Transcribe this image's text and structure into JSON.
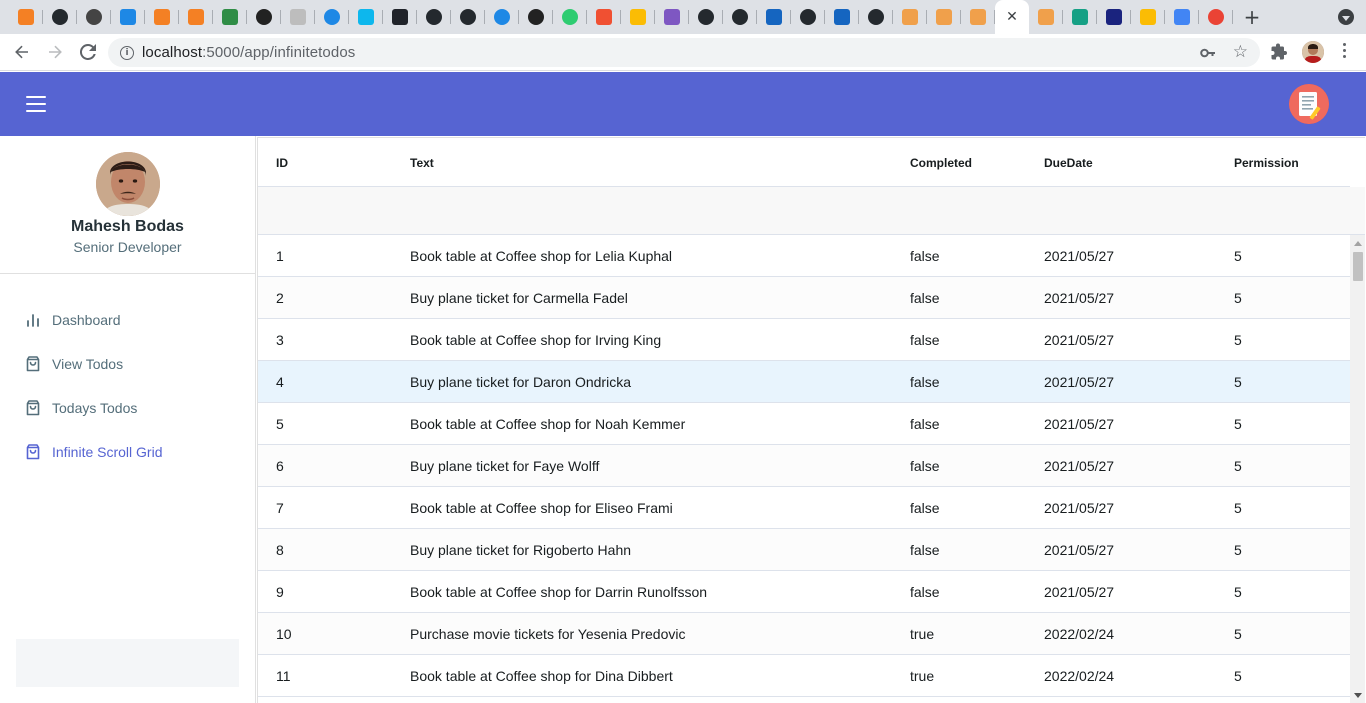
{
  "browser": {
    "active_tab_close": "✕",
    "new_tab": "+",
    "tab_favicons": [
      {
        "name": "stackoverflow-favicon",
        "color": "#f48024"
      },
      {
        "name": "github-favicon",
        "color": "#24292e"
      },
      {
        "name": "eye-favicon",
        "color": "#444444"
      },
      {
        "name": "blue-favicon",
        "color": "#1e88e5"
      },
      {
        "name": "stackoverflow-favicon",
        "color": "#f48024"
      },
      {
        "name": "stackoverflow-favicon",
        "color": "#f48024"
      },
      {
        "name": "geeksforgeeks-favicon",
        "color": "#2f8d46"
      },
      {
        "name": "hexagon-favicon",
        "color": "#222222"
      },
      {
        "name": "doc-favicon",
        "color": "#bdbdbd"
      },
      {
        "name": "edge-favicon",
        "color": "#1e88e5"
      },
      {
        "name": "docker-favicon",
        "color": "#0db7ed"
      },
      {
        "name": "react-favicon",
        "color": "#20232a"
      },
      {
        "name": "github-favicon",
        "color": "#24292e"
      },
      {
        "name": "github-favicon",
        "color": "#24292e"
      },
      {
        "name": "edge-favicon",
        "color": "#1e88e5"
      },
      {
        "name": "hexagon-favicon",
        "color": "#222222"
      },
      {
        "name": "green-dot-favicon",
        "color": "#2ecc71"
      },
      {
        "name": "git-favicon",
        "color": "#f05032"
      },
      {
        "name": "drive-favicon",
        "color": "#fbbc04"
      },
      {
        "name": "purple-favicon",
        "color": "#7e57c2"
      },
      {
        "name": "github-favicon",
        "color": "#24292e"
      },
      {
        "name": "github-favicon",
        "color": "#24292e"
      },
      {
        "name": "jira-favicon",
        "color": "#1565c0"
      },
      {
        "name": "github-favicon",
        "color": "#24292e"
      },
      {
        "name": "jira-favicon",
        "color": "#1565c0"
      },
      {
        "name": "github-favicon",
        "color": "#24292e"
      },
      {
        "name": "app-favicon",
        "color": "#f0a04b"
      },
      {
        "name": "app-favicon",
        "color": "#f0a04b"
      },
      {
        "name": "app-favicon",
        "color": "#f0a04b"
      },
      {
        "name": "app-favicon-active",
        "color": "#f0a04b",
        "active": true
      },
      {
        "name": "app-favicon",
        "color": "#f0a04b"
      },
      {
        "name": "terminal-favicon",
        "color": "#16a085"
      },
      {
        "name": "news-favicon",
        "color": "#1a237e"
      },
      {
        "name": "drive-favicon",
        "color": "#fbbc04"
      },
      {
        "name": "docs-favicon",
        "color": "#4285f4"
      },
      {
        "name": "google-favicon",
        "color": "#ea4335"
      }
    ],
    "url_host": "localhost",
    "url_path": ":5000/app/infinitetodos"
  },
  "colors": {
    "appbar": "#5664d2",
    "active_nav": "#5664d2",
    "row_highlight": "#e8f4fd"
  },
  "user": {
    "name": "Mahesh Bodas",
    "role": "Senior Developer"
  },
  "nav": [
    {
      "label": "Dashboard",
      "icon": "bar-chart-icon",
      "active": false
    },
    {
      "label": "View Todos",
      "icon": "shopping-bag-icon",
      "active": false
    },
    {
      "label": "Todays Todos",
      "icon": "shopping-bag-icon",
      "active": false
    },
    {
      "label": "Infinite Scroll Grid",
      "icon": "shopping-bag-icon",
      "active": true
    }
  ],
  "grid": {
    "columns": [
      "ID",
      "Text",
      "Completed",
      "DueDate",
      "Permission"
    ],
    "highlighted_row": 3,
    "rows": [
      [
        "1",
        "Book table at Coffee shop for Lelia Kuphal",
        "false",
        "2021/05/27",
        "5"
      ],
      [
        "2",
        "Buy plane ticket for Carmella Fadel",
        "false",
        "2021/05/27",
        "5"
      ],
      [
        "3",
        "Book table at Coffee shop for Irving King",
        "false",
        "2021/05/27",
        "5"
      ],
      [
        "4",
        "Buy plane ticket for Daron Ondricka",
        "false",
        "2021/05/27",
        "5"
      ],
      [
        "5",
        "Book table at Coffee shop for Noah Kemmer",
        "false",
        "2021/05/27",
        "5"
      ],
      [
        "6",
        "Buy plane ticket for Faye Wolff",
        "false",
        "2021/05/27",
        "5"
      ],
      [
        "7",
        "Book table at Coffee shop for Eliseo Frami",
        "false",
        "2021/05/27",
        "5"
      ],
      [
        "8",
        "Buy plane ticket for Rigoberto Hahn",
        "false",
        "2021/05/27",
        "5"
      ],
      [
        "9",
        "Book table at Coffee shop for Darrin Runolfsson",
        "false",
        "2021/05/27",
        "5"
      ],
      [
        "10",
        "Purchase movie tickets for Yesenia Predovic",
        "true",
        "2022/02/24",
        "5"
      ],
      [
        "11",
        "Book table at Coffee shop for Dina Dibbert",
        "true",
        "2022/02/24",
        "5"
      ]
    ]
  }
}
